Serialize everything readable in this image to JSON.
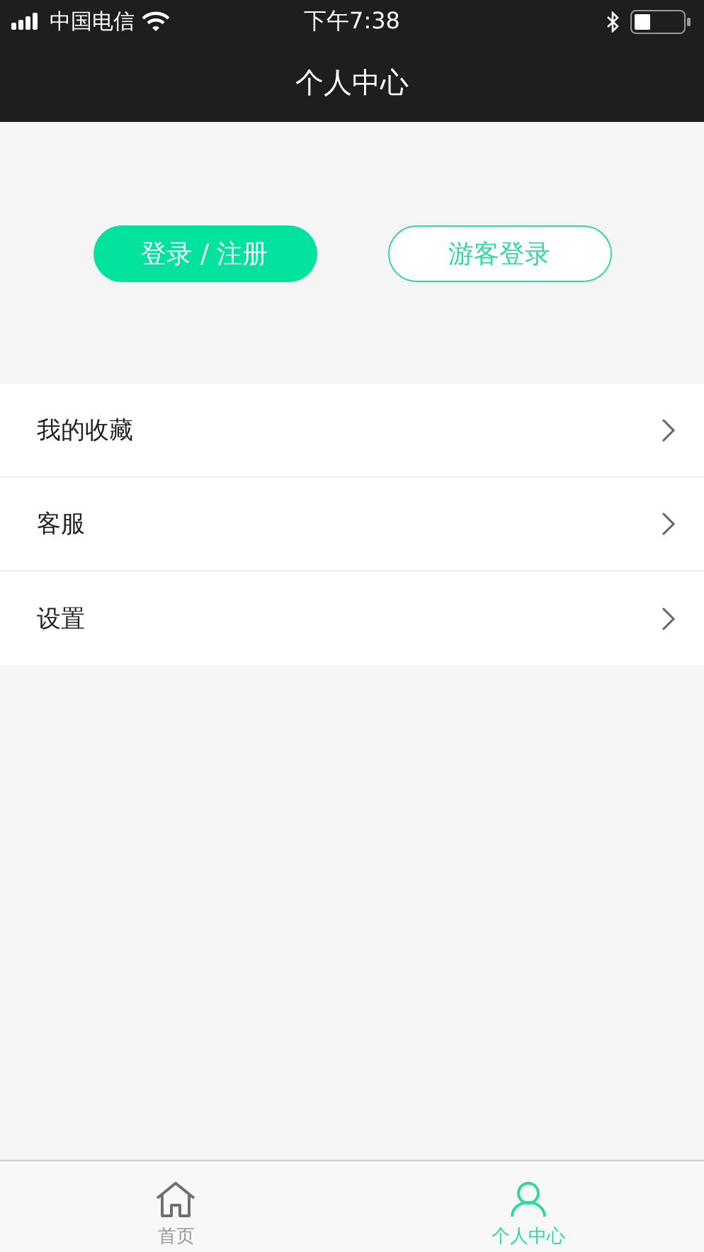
{
  "status_bar": {
    "carrier": "中国电信",
    "time": "下午7:38"
  },
  "nav_bar": {
    "title": "个人中心"
  },
  "login_buttons": [
    {
      "label": "登录 / 注册",
      "kind": "filled"
    },
    {
      "label": "游客登录",
      "kind": "outline"
    }
  ],
  "menu": [
    {
      "label": "我的收藏"
    },
    {
      "label": "客服"
    },
    {
      "label": "设置"
    }
  ],
  "tab_bar": [
    {
      "label": "首页",
      "kind": "home",
      "selected": false
    },
    {
      "label": "个人中心",
      "kind": "person",
      "selected": true
    }
  ]
}
